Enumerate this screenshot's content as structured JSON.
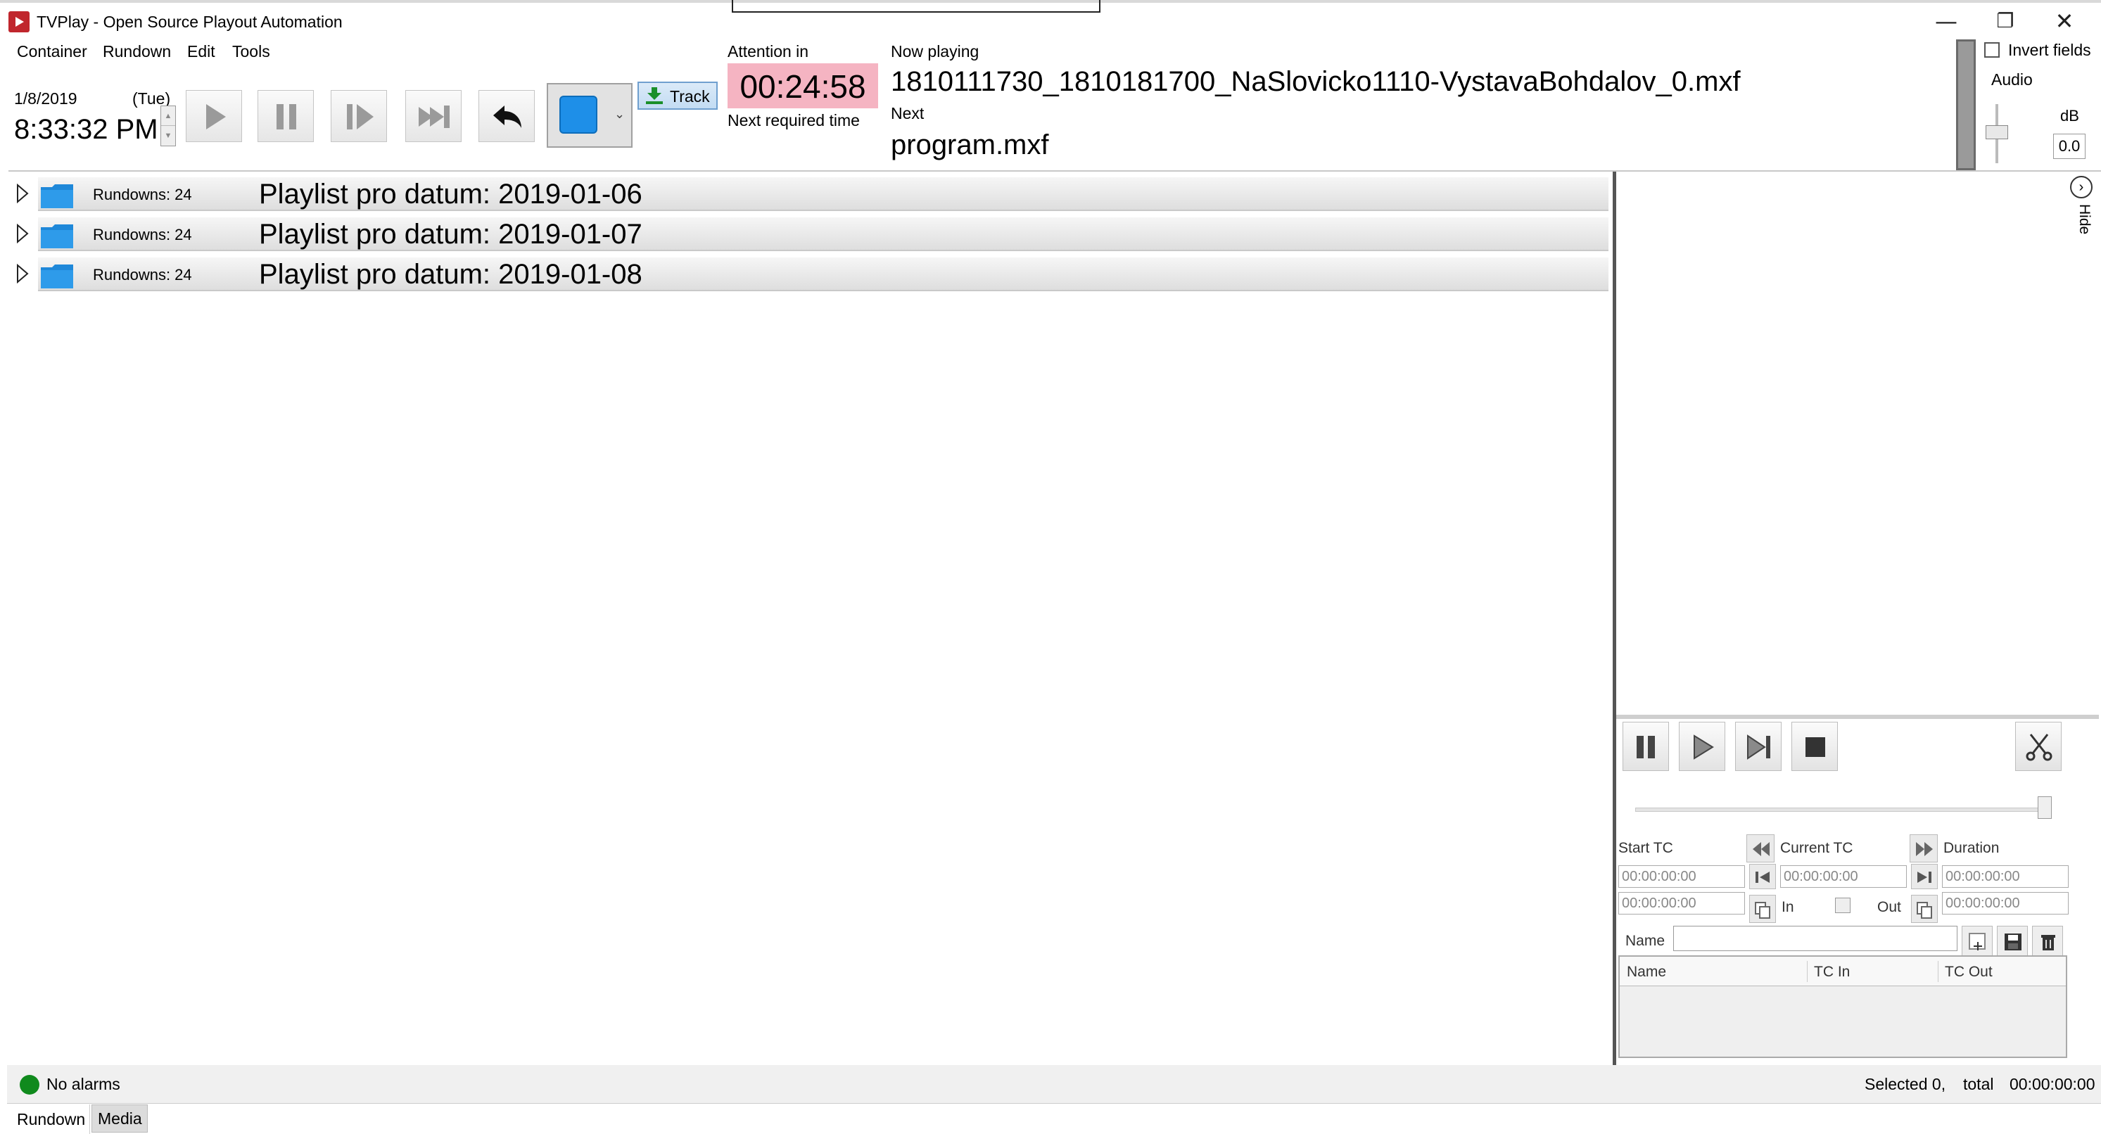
{
  "window": {
    "title": "TVPlay - Open Source Playout Automation",
    "minimize": "—",
    "restore": "❐",
    "close": "✕"
  },
  "menu": [
    "Container",
    "Rundown",
    "Edit",
    "Tools"
  ],
  "clock": {
    "date": "1/8/2019",
    "weekday": "(Tue)",
    "time": "8:33:32 PM"
  },
  "toolbar": {
    "buttons": [
      "play-icon",
      "pause-icon",
      "step-icon",
      "force-next-icon",
      "undo-icon",
      "stop-icon"
    ],
    "track_label": "Track"
  },
  "attention": {
    "label": "Attention in",
    "time": "00:24:58",
    "next_required_label": "Next required time",
    "color": "#f5b4c2"
  },
  "now_playing": {
    "label": "Now playing",
    "value": "1810111730_1810181700_NaSlovicko1110-VystavaBohdalov_0.mxf",
    "next_label": "Next",
    "next_value": "program.mxf"
  },
  "audio": {
    "invert_fields_label": "Invert fields",
    "audio_label": "Audio",
    "db_label": "dB",
    "db_value": "0.0"
  },
  "rundowns": [
    {
      "count": "Rundowns: 24",
      "title": "Playlist pro datum: 2019-01-06"
    },
    {
      "count": "Rundowns: 24",
      "title": "Playlist pro datum: 2019-01-07"
    },
    {
      "count": "Rundowns: 24",
      "title": "Playlist pro datum: 2019-01-08"
    }
  ],
  "side_panel": {
    "hide_label": "Hide",
    "start_tc_label": "Start TC",
    "current_tc_label": "Current TC",
    "duration_label": "Duration",
    "start_tc": "00:00:00:00",
    "current_tc": "00:00:00:00",
    "duration": "00:00:00:00",
    "tc_in": "00:00:00:00",
    "tc_out": "00:00:00:00",
    "in_label": "In",
    "out_label": "Out",
    "name_label": "Name",
    "table_headers": [
      "Name",
      "TC In",
      "TC Out"
    ]
  },
  "status": {
    "alarm_text": "No alarms",
    "alarm_color": "#108a1d",
    "selected": "Selected 0,",
    "total_label": "total",
    "total_value": "00:00:00:00"
  },
  "tabs": [
    "Rundown",
    "Media"
  ]
}
